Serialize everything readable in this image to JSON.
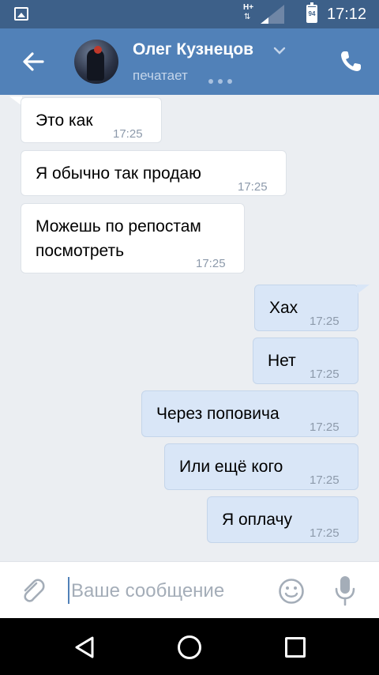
{
  "status_bar": {
    "network": "H+",
    "network_arrows": "⇅",
    "battery": "94",
    "time": "17:12"
  },
  "header": {
    "title": "Олег Кузнецов",
    "subtitle": "печатает"
  },
  "messages": [
    {
      "direction": "in",
      "text": "Это как",
      "time": "17:25"
    },
    {
      "direction": "in",
      "text": "Я обычно так продаю",
      "time": "17:25"
    },
    {
      "direction": "in",
      "text_line1": "Можешь по репостам",
      "text_line2": "посмотреть",
      "time": "17:25"
    },
    {
      "direction": "out",
      "text": "Хах",
      "time": "17:25"
    },
    {
      "direction": "out",
      "text": "Нет",
      "time": "17:25"
    },
    {
      "direction": "out",
      "text": "Через поповича",
      "time": "17:25"
    },
    {
      "direction": "out",
      "text": "Или ещё кого",
      "time": "17:25"
    },
    {
      "direction": "out",
      "text": "Я оплачу",
      "time": "17:25"
    }
  ],
  "composer": {
    "placeholder": "Ваше сообщение",
    "value": ""
  },
  "colors": {
    "header": "#5181b8",
    "status_bar": "#3d6089",
    "background": "#ebeef2",
    "bubble_in": "#ffffff",
    "bubble_out": "#d9e6f7"
  }
}
